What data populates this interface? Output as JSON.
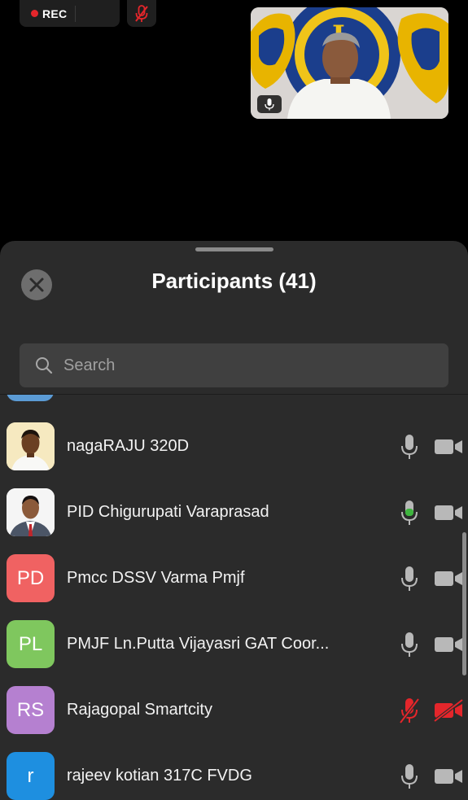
{
  "recording": {
    "label": "REC"
  },
  "colors": {
    "panel_bg": "#2b2b2b",
    "rec_red": "#e4262b",
    "active_green": "#3fb53f",
    "muted_red": "#e4262b",
    "icon_gray": "#b8b8b8"
  },
  "panel": {
    "title": "Participants (41)",
    "search_placeholder": "Search"
  },
  "participants": [
    {
      "name": "nagaRAJU 320D",
      "initials": "",
      "avatar_type": "photo",
      "avatar_color": "#f4e6b8",
      "mic": "on",
      "video": "off"
    },
    {
      "name": "PID Chigurupati Varaprasad",
      "initials": "",
      "avatar_type": "photo",
      "avatar_color": "#f2f2f2",
      "mic": "speaking",
      "video": "off"
    },
    {
      "name": "Pmcc DSSV Varma Pmjf",
      "initials": "PD",
      "avatar_type": "initials",
      "avatar_color": "#f06262",
      "mic": "on",
      "video": "off"
    },
    {
      "name": "PMJF Ln.Putta Vijayasri  GAT Coor...",
      "initials": "PL",
      "avatar_type": "initials",
      "avatar_color": "#7fc75e",
      "mic": "on",
      "video": "off"
    },
    {
      "name": "Rajagopal Smartcity",
      "initials": "RS",
      "avatar_type": "initials",
      "avatar_color": "#b580d0",
      "mic": "muted",
      "video": "muted"
    },
    {
      "name": "rajeev kotian 317C FVDG",
      "initials": "r",
      "avatar_type": "initials",
      "avatar_color": "#1e8fe0",
      "mic": "on",
      "video": "off"
    }
  ]
}
